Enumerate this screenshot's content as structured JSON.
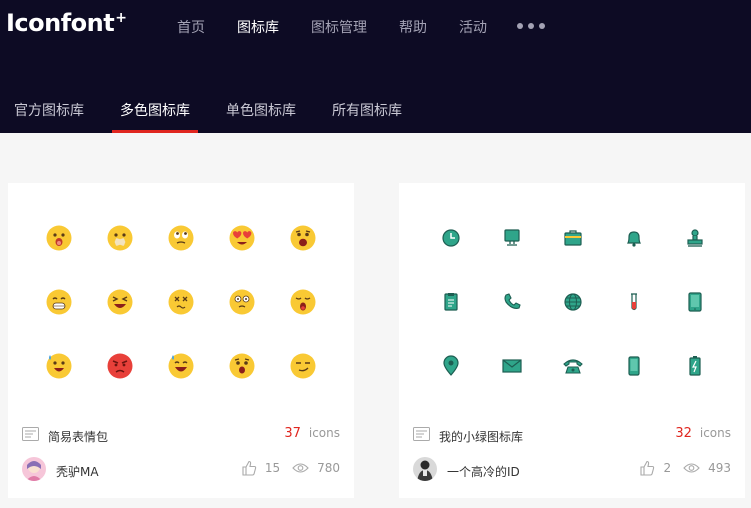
{
  "header": {
    "logo": "Iconfont",
    "logo_plus": "+",
    "nav": [
      {
        "label": "首页",
        "active": false
      },
      {
        "label": "图标库",
        "active": true
      },
      {
        "label": "图标管理",
        "active": false
      },
      {
        "label": "帮助",
        "active": false
      },
      {
        "label": "活动",
        "active": false
      }
    ],
    "more_icon": "more-dots-icon"
  },
  "subtabs": [
    {
      "label": "官方图标库",
      "active": false
    },
    {
      "label": "多色图标库",
      "active": true
    },
    {
      "label": "单色图标库",
      "active": false
    },
    {
      "label": "所有图标库",
      "active": false
    }
  ],
  "colors": {
    "header_bg": "#0d0b24",
    "accent_red": "#e0261f",
    "emoji_yellow": "#f9c934",
    "emoji_red": "#e8403a",
    "teal": "#2fa58a"
  },
  "cards": [
    {
      "name": "简易表情包",
      "count": "37",
      "count_label": "icons",
      "author": "秃驴MA",
      "likes": "15",
      "views": "780",
      "icons": [
        "surprised-face-icon",
        "mouth-taped-face-icon",
        "eye-roll-face-icon",
        "heart-eyes-face-icon",
        "shocked-face-icon",
        "grimace-face-icon",
        "squint-laugh-face-icon",
        "dizzy-face-icon",
        "dazed-face-icon",
        "yawning-face-icon",
        "sweat-face-icon",
        "angry-face-icon",
        "sweat-smile-face-icon",
        "scared-face-icon",
        "smirk-face-icon"
      ]
    },
    {
      "name": "我的小绿图标库",
      "count": "32",
      "count_label": "icons",
      "author": "一个高冷的ID",
      "likes": "2",
      "views": "493",
      "icons": [
        "clock-icon",
        "monitor-icon",
        "briefcase-icon",
        "bell-icon",
        "stamp-icon",
        "clipboard-icon",
        "phone-icon",
        "globe-icon",
        "test-tube-icon",
        "tablet-icon",
        "map-pin-icon",
        "envelope-icon",
        "telephone-icon",
        "smartphone-icon",
        "battery-icon"
      ]
    }
  ]
}
